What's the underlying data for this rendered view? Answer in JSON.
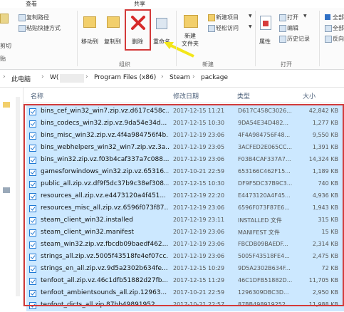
{
  "ribbon_tabs": [
    "共享",
    "查看"
  ],
  "ribbon": {
    "clipboard": {
      "copy_path": "复制路径",
      "paste_shortcut": "粘贴快捷方式",
      "cut_fragment": "剪切",
      "paste_fragment": "贴"
    },
    "organize": {
      "move_to": "移动到",
      "copy_to": "复制到",
      "delete": "删除",
      "rename": "重命名",
      "group_label": "组织"
    },
    "new": {
      "new_folder": "新建\n文件夹",
      "new_item": "新建项目",
      "easy_access": "轻松访问",
      "group_label": "新建"
    },
    "open": {
      "properties": "属性",
      "open": "打开",
      "edit": "编辑",
      "history": "历史记录",
      "group_label": "打开"
    },
    "select": {
      "select_all": "全部",
      "select_none": "全部",
      "invert": "反向"
    }
  },
  "address": {
    "crumbs": [
      "此电脑",
      "W(",
      "Program Files (x86)",
      "Steam",
      "package"
    ]
  },
  "columns": {
    "name": "名称",
    "date": "修改日期",
    "type": "类型",
    "size": "大小"
  },
  "files": [
    {
      "name": "bins_cef_win32_win7.zip.vz.d617c458c...",
      "date": "2017-12-15 11:21",
      "type": "D617C458C3026...",
      "size": "42,842 KB"
    },
    {
      "name": "bins_codecs_win32.zip.vz.9da54e34d...",
      "date": "2017-12-15 10:30",
      "type": "9DA54E34D482...",
      "size": "1,277 KB"
    },
    {
      "name": "bins_misc_win32.zip.vz.4f4a984756f4b...",
      "date": "2017-12-19 23:06",
      "type": "4F4A984756F48...",
      "size": "9,550 KB"
    },
    {
      "name": "bins_webhelpers_win32_win7.zip.vz.3a...",
      "date": "2017-12-19 23:05",
      "type": "3ACFED2E065CC...",
      "size": "1,391 KB"
    },
    {
      "name": "bins_win32.zip.vz.f03b4caf337a7c088...",
      "date": "2017-12-19 23:06",
      "type": "F03B4CAF337A7...",
      "size": "14,324 KB"
    },
    {
      "name": "gamesforwindows_win32.zip.vz.65316...",
      "date": "2017-10-21 22:59",
      "type": "653166C462F15...",
      "size": "1,189 KB"
    },
    {
      "name": "public_all.zip.vz.df9f5dc37b9c38ef308...",
      "date": "2017-12-15 10:30",
      "type": "DF9F5DC37B9C3...",
      "size": "740 KB"
    },
    {
      "name": "resources_all.zip.vz.e4473120a4f451...",
      "date": "2017-12-19 22:20",
      "type": "E4473120A4F45...",
      "size": "4,936 KB"
    },
    {
      "name": "resources_misc_all.zip.vz.6596f073f87...",
      "date": "2017-12-19 23:06",
      "type": "6596F073F87E6...",
      "size": "1,943 KB"
    },
    {
      "name": "steam_client_win32.installed",
      "date": "2017-12-19 23:11",
      "type": "INSTALLED 文件",
      "size": "315 KB"
    },
    {
      "name": "steam_client_win32.manifest",
      "date": "2017-12-19 23:06",
      "type": "MANIFEST 文件",
      "size": "15 KB"
    },
    {
      "name": "steam_win32.zip.vz.fbcdb09baedf462...",
      "date": "2017-12-19 23:06",
      "type": "FBCDB09BAEDF...",
      "size": "2,314 KB"
    },
    {
      "name": "strings_all.zip.vz.5005f43518fe4ef07cc...",
      "date": "2017-12-19 23:06",
      "type": "5005F43518FE4...",
      "size": "2,475 KB"
    },
    {
      "name": "strings_en_all.zip.vz.9d5a2302b634fe...",
      "date": "2017-12-15 10:29",
      "type": "9D5A2302B634F...",
      "size": "72 KB"
    },
    {
      "name": "tenfoot_all.zip.vz.46c1dfb51882d27fb...",
      "date": "2017-12-15 11:29",
      "type": "46C1DFB51882D...",
      "size": "11,705 KB"
    },
    {
      "name": "tenfoot_ambientsounds_all.zip.12963...",
      "date": "2017-10-21 22:59",
      "type": "1296309DBC3D...",
      "size": "2,950 KB"
    },
    {
      "name": "tenfoot_dicts_all.zip.87bb49891952...",
      "date": "2017-10-21 22:57",
      "type": "87BB498919252...",
      "size": "11,988 KB"
    }
  ],
  "colors": {
    "selection": "#cce8ff",
    "highlight_red": "#d33a3a",
    "arrow_yellow": "#f3e61a"
  }
}
